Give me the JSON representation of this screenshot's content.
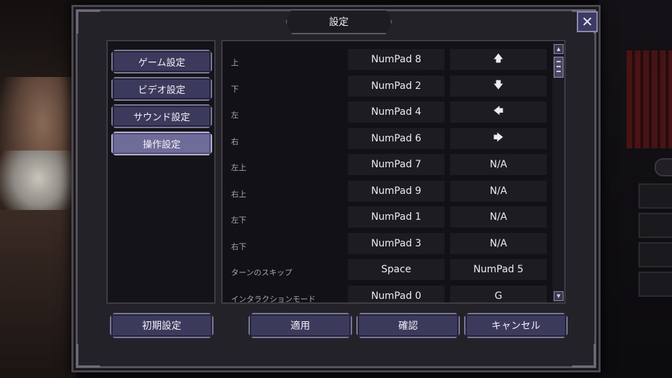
{
  "dialog": {
    "title": "設定",
    "close_symbol": "✕"
  },
  "nav": {
    "items": [
      {
        "label": "ゲーム設定",
        "active": false
      },
      {
        "label": "ビデオ設定",
        "active": false
      },
      {
        "label": "サウンド設定",
        "active": false
      },
      {
        "label": "操作設定",
        "active": true
      }
    ]
  },
  "bindings": [
    {
      "action": "上",
      "primary": "NumPad 8",
      "secondary": "🡅"
    },
    {
      "action": "下",
      "primary": "NumPad 2",
      "secondary": "🡇"
    },
    {
      "action": "左",
      "primary": "NumPad 4",
      "secondary": "🡄"
    },
    {
      "action": "右",
      "primary": "NumPad 6",
      "secondary": "🡆"
    },
    {
      "action": "左上",
      "primary": "NumPad 7",
      "secondary": "N/A"
    },
    {
      "action": "右上",
      "primary": "NumPad 9",
      "secondary": "N/A"
    },
    {
      "action": "左下",
      "primary": "NumPad 1",
      "secondary": "N/A"
    },
    {
      "action": "右下",
      "primary": "NumPad 3",
      "secondary": "N/A"
    },
    {
      "action": "ターンのスキップ",
      "primary": "Space",
      "secondary": "NumPad 5"
    },
    {
      "action": "インタラクションモード",
      "primary": "NumPad 0",
      "secondary": "G"
    }
  ],
  "buttons": {
    "reset": "初期設定",
    "apply": "適用",
    "confirm": "確認",
    "cancel": "キャンセル"
  },
  "scrollbar": {
    "up_symbol": "▲",
    "down_symbol": "▼"
  }
}
